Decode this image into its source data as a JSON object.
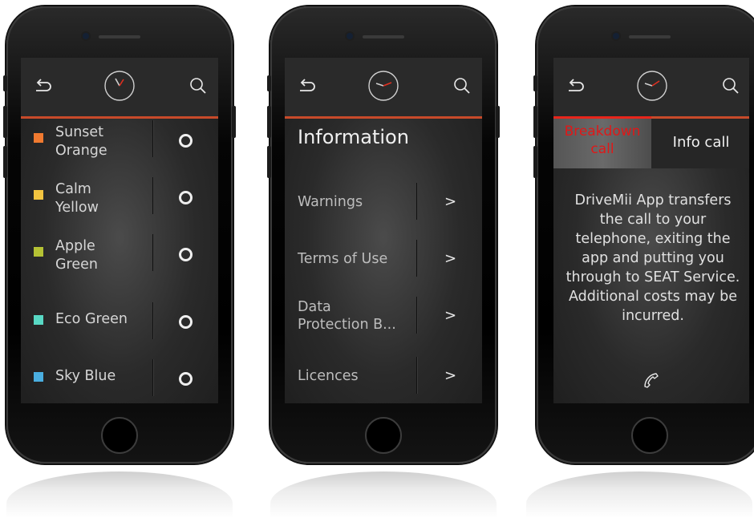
{
  "screens": {
    "colors": {
      "items": [
        {
          "label_1": "Sunset",
          "label_2": "Orange",
          "color": "#f07a30"
        },
        {
          "label_1": "Calm",
          "label_2": "Yellow",
          "color": "#f2c440"
        },
        {
          "label_1": "Apple",
          "label_2": "Green",
          "color": "#b5c234"
        },
        {
          "label_1": "Eco Green",
          "label_2": "",
          "color": "#58d8c4"
        },
        {
          "label_1": "Sky Blue",
          "label_2": "",
          "color": "#4aaee0"
        }
      ]
    },
    "information": {
      "title": "Information",
      "items": [
        {
          "label_1": "Warnings",
          "label_2": ""
        },
        {
          "label_1": "Terms of Use",
          "label_2": ""
        },
        {
          "label_1": "Data",
          "label_2": "Protection B..."
        },
        {
          "label_1": "Licences",
          "label_2": ""
        }
      ],
      "chevron": ">"
    },
    "call": {
      "tabs": [
        {
          "line_1": "Breakdown",
          "line_2": "call"
        },
        {
          "label": "Info call"
        }
      ],
      "message_lines": [
        "DriveMii App transfers",
        "the call to your",
        "telephone, exiting the",
        "app and putting you",
        "through to SEAT Service.",
        "Additional costs may be",
        "incurred."
      ]
    }
  },
  "icons": {
    "back": "back-arrow-icon",
    "clock": "clock-icon",
    "search": "search-icon",
    "call": "phone-handset-icon"
  },
  "colors": {
    "accent_line": "#c84a2a",
    "active_tab_bar": "#e8251b",
    "breakdown_text": "#e01818"
  }
}
